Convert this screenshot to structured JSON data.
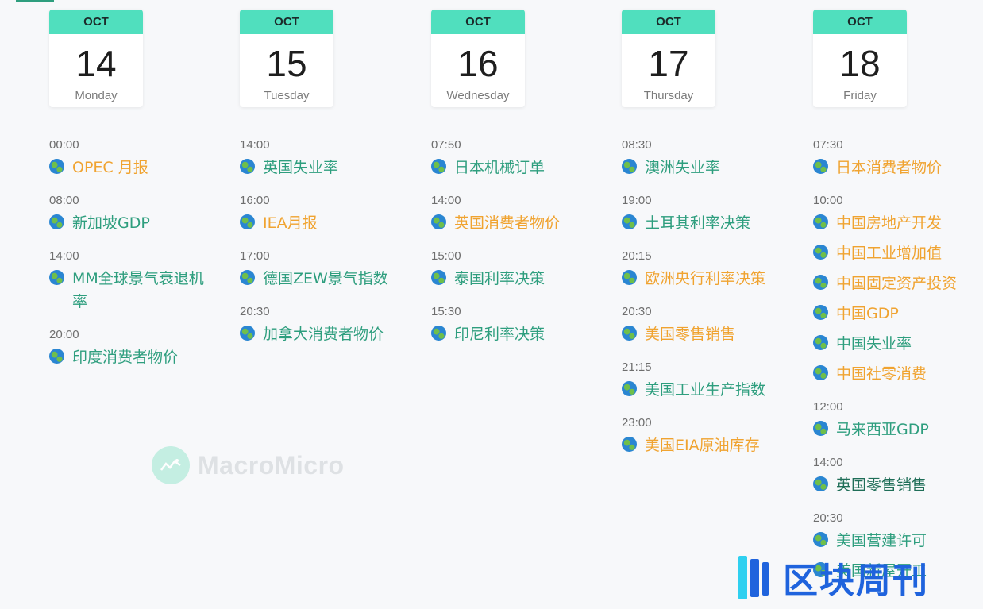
{
  "colors": {
    "accent": "#50dfbe",
    "event_green": "#2e9e7e",
    "event_orange": "#f0a330",
    "event_active": "#1f6e58"
  },
  "days": [
    {
      "month": "OCT",
      "day": "14",
      "weekday": "Monday",
      "groups": [
        {
          "time": "00:00",
          "events": [
            {
              "name": "OPEC 月报",
              "color": "orange",
              "icon": "globe-icon"
            }
          ]
        },
        {
          "time": "08:00",
          "events": [
            {
              "name": "新加坡GDP",
              "color": "green",
              "icon": "globe-icon"
            }
          ]
        },
        {
          "time": "14:00",
          "events": [
            {
              "name": "MM全球景气衰退机率",
              "color": "green",
              "icon": "globe-icon"
            }
          ]
        },
        {
          "time": "20:00",
          "events": [
            {
              "name": "印度消费者物价",
              "color": "green",
              "icon": "globe-icon"
            }
          ]
        }
      ]
    },
    {
      "month": "OCT",
      "day": "15",
      "weekday": "Tuesday",
      "groups": [
        {
          "time": "14:00",
          "events": [
            {
              "name": "英国失业率",
              "color": "green",
              "icon": "globe-icon"
            }
          ]
        },
        {
          "time": "16:00",
          "events": [
            {
              "name": "IEA月报",
              "color": "orange",
              "icon": "globe-icon"
            }
          ]
        },
        {
          "time": "17:00",
          "events": [
            {
              "name": "德国ZEW景气指数",
              "color": "green",
              "icon": "globe-icon"
            }
          ]
        },
        {
          "time": "20:30",
          "events": [
            {
              "name": "加拿大消费者物价",
              "color": "green",
              "icon": "globe-icon"
            }
          ]
        }
      ]
    },
    {
      "month": "OCT",
      "day": "16",
      "weekday": "Wednesday",
      "groups": [
        {
          "time": "07:50",
          "events": [
            {
              "name": "日本机械订单",
              "color": "green",
              "icon": "globe-icon"
            }
          ]
        },
        {
          "time": "14:00",
          "events": [
            {
              "name": "英国消费者物价",
              "color": "orange",
              "icon": "globe-icon"
            }
          ]
        },
        {
          "time": "15:00",
          "events": [
            {
              "name": "泰国利率决策",
              "color": "green",
              "icon": "globe-icon"
            }
          ]
        },
        {
          "time": "15:30",
          "events": [
            {
              "name": "印尼利率决策",
              "color": "green",
              "icon": "globe-icon"
            }
          ]
        }
      ]
    },
    {
      "month": "OCT",
      "day": "17",
      "weekday": "Thursday",
      "groups": [
        {
          "time": "08:30",
          "events": [
            {
              "name": "澳洲失业率",
              "color": "green",
              "icon": "globe-icon"
            }
          ]
        },
        {
          "time": "19:00",
          "events": [
            {
              "name": "土耳其利率决策",
              "color": "green",
              "icon": "globe-icon"
            }
          ]
        },
        {
          "time": "20:15",
          "events": [
            {
              "name": "欧洲央行利率决策",
              "color": "orange",
              "icon": "globe-icon"
            }
          ]
        },
        {
          "time": "20:30",
          "events": [
            {
              "name": "美国零售销售",
              "color": "orange",
              "icon": "globe-icon"
            }
          ]
        },
        {
          "time": "21:15",
          "events": [
            {
              "name": "美国工业生产指数",
              "color": "green",
              "icon": "globe-icon"
            }
          ]
        },
        {
          "time": "23:00",
          "events": [
            {
              "name": "美国EIA原油库存",
              "color": "orange",
              "icon": "globe-icon"
            }
          ]
        }
      ]
    },
    {
      "month": "OCT",
      "day": "18",
      "weekday": "Friday",
      "groups": [
        {
          "time": "07:30",
          "events": [
            {
              "name": "日本消费者物价",
              "color": "orange",
              "icon": "globe-icon"
            }
          ]
        },
        {
          "time": "10:00",
          "events": [
            {
              "name": "中国房地产开发",
              "color": "orange",
              "icon": "globe-icon"
            },
            {
              "name": "中国工业增加值",
              "color": "orange",
              "icon": "globe-icon"
            },
            {
              "name": "中国固定资产投资",
              "color": "orange",
              "icon": "globe-icon"
            },
            {
              "name": "中国GDP",
              "color": "orange",
              "icon": "globe-icon"
            },
            {
              "name": "中国失业率",
              "color": "green",
              "icon": "globe-icon"
            },
            {
              "name": "中国社零消费",
              "color": "orange",
              "icon": "globe-icon"
            }
          ]
        },
        {
          "time": "12:00",
          "events": [
            {
              "name": "马来西亚GDP",
              "color": "green",
              "icon": "globe-icon"
            }
          ]
        },
        {
          "time": "14:00",
          "events": [
            {
              "name": "英国零售销售",
              "color": "active",
              "icon": "globe-icon"
            }
          ]
        },
        {
          "time": "20:30",
          "events": [
            {
              "name": "美国营建许可",
              "color": "green",
              "icon": "globe-icon"
            },
            {
              "name": "美国新屋开工",
              "color": "green",
              "icon": "globe-icon"
            }
          ]
        }
      ]
    }
  ],
  "watermarks": {
    "macromicro": "MacroMicro",
    "block_weekly": "区块周刊"
  }
}
